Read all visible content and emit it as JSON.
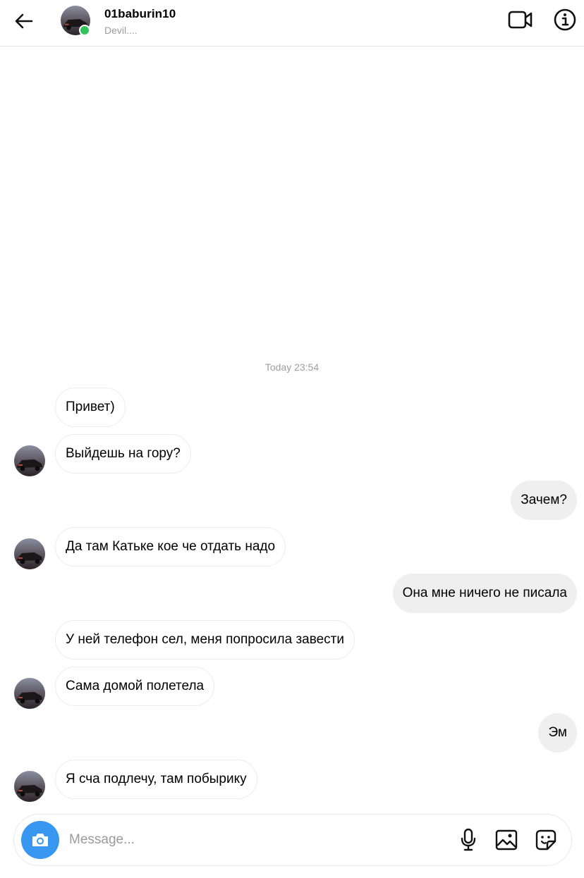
{
  "header": {
    "username": "01baburin10",
    "status": "Devil....",
    "icons": {
      "back": "arrow-left-icon",
      "video": "video-camera-icon",
      "info": "info-circle-icon"
    },
    "online_color": "#33c35a"
  },
  "thread": {
    "timestamp": "Today 23:54",
    "messages": [
      {
        "direction": "incoming",
        "text": "Привет)",
        "show_avatar": false
      },
      {
        "direction": "incoming",
        "text": "Выйдешь на гору?",
        "show_avatar": true
      },
      {
        "direction": "outgoing",
        "text": "Зачем?"
      },
      {
        "direction": "incoming",
        "text": "Да там Катьке кое че отдать надо",
        "show_avatar": true
      },
      {
        "direction": "outgoing",
        "text": "Она мне ничего не писала"
      },
      {
        "direction": "incoming",
        "text": "У ней телефон сел, меня попросила завести",
        "show_avatar": false
      },
      {
        "direction": "incoming",
        "text": "Сама домой полетела",
        "show_avatar": true
      },
      {
        "direction": "outgoing",
        "text": "Эм"
      },
      {
        "direction": "incoming",
        "text": "Я сча подлечу, там побырику",
        "show_avatar": true
      }
    ]
  },
  "composer": {
    "placeholder": "Message...",
    "value": "",
    "icons": {
      "camera": "camera-icon",
      "mic": "microphone-icon",
      "gallery": "image-gallery-icon",
      "sticker": "sticker-icon"
    },
    "accent_color": "#3897f0"
  },
  "colors": {
    "incoming_bubble": "#ffffff",
    "outgoing_bubble": "#efefef",
    "muted_text": "#9a9a9a"
  }
}
